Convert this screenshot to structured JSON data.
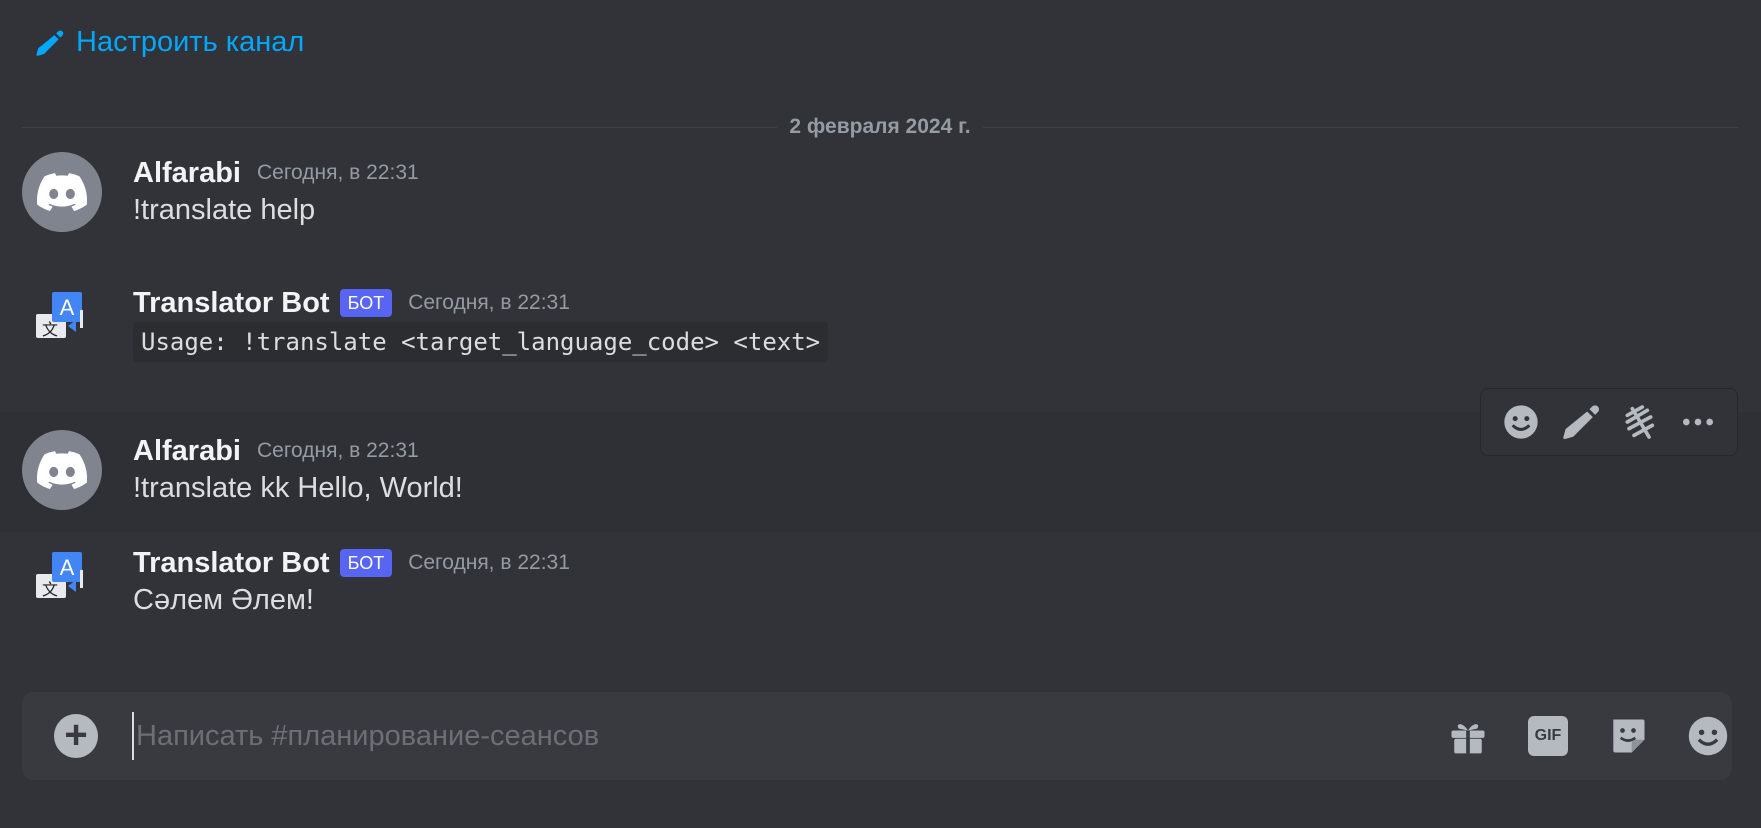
{
  "header": {
    "setup_channel_label": "Настроить канал"
  },
  "divider": {
    "date": "2 февраля 2024 г."
  },
  "messages": [
    {
      "author": "Alfarabi",
      "is_bot": false,
      "timestamp": "Сегодня, в 22:31",
      "content": "!translate help",
      "is_code": false
    },
    {
      "author": "Translator Bot",
      "is_bot": true,
      "bot_tag": "БОТ",
      "timestamp": "Сегодня, в 22:31",
      "content": "Usage: !translate <target_language_code> <text>",
      "is_code": true
    },
    {
      "author": "Alfarabi",
      "is_bot": false,
      "timestamp": "Сегодня, в 22:31",
      "content": "!translate kk Hello, World!",
      "is_code": false
    },
    {
      "author": "Translator Bot",
      "is_bot": true,
      "bot_tag": "БОТ",
      "timestamp": "Сегодня, в 22:31",
      "content": "Сәлем Әлем!",
      "is_code": false
    }
  ],
  "hover_toolbar": {
    "icons": [
      "emoji-icon",
      "edit-icon",
      "thread-icon",
      "more-icon"
    ]
  },
  "composer": {
    "placeholder": "Написать #планирование-сеансов",
    "gif_label": "GIF",
    "icons": [
      "plus-icon",
      "gift-icon",
      "gif-icon",
      "sticker-icon",
      "emoji-icon"
    ]
  },
  "colors": {
    "background": "#313338",
    "accent_link": "#00a8fc",
    "bot_tag": "#5865f2",
    "composer_bg": "#383a40"
  }
}
